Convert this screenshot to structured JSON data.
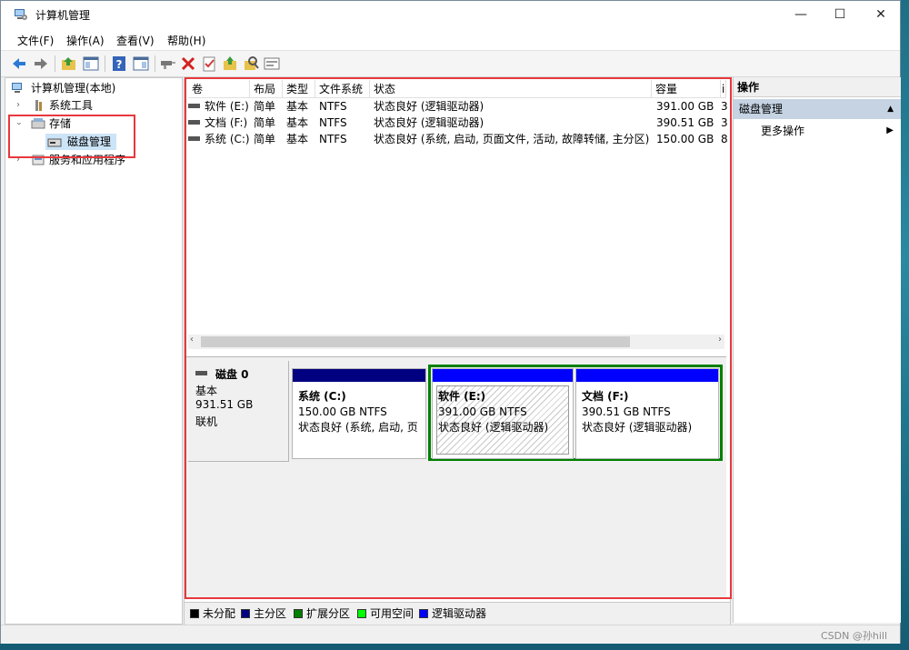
{
  "window": {
    "title": "计算机管理"
  },
  "menu": [
    "文件(F)",
    "操作(A)",
    "查看(V)",
    "帮助(H)"
  ],
  "tree": {
    "root": "计算机管理(本地)",
    "system_tools": "系统工具",
    "storage": "存储",
    "disk_mgmt": "磁盘管理",
    "services": "服务和应用程序"
  },
  "volumes": {
    "headers": [
      "卷",
      "布局",
      "类型",
      "文件系统",
      "状态",
      "容量",
      "i"
    ],
    "rows": [
      {
        "name": "软件 (E:)",
        "layout": "简单",
        "type": "基本",
        "fs": "NTFS",
        "status": "状态良好 (逻辑驱动器)",
        "capacity": "391.00 GB",
        "extra": "3"
      },
      {
        "name": "文档 (F:)",
        "layout": "简单",
        "type": "基本",
        "fs": "NTFS",
        "status": "状态良好 (逻辑驱动器)",
        "capacity": "390.51 GB",
        "extra": "3"
      },
      {
        "name": "系统 (C:)",
        "layout": "简单",
        "type": "基本",
        "fs": "NTFS",
        "status": "状态良好 (系统, 启动, 页面文件, 活动, 故障转储, 主分区)",
        "capacity": "150.00 GB",
        "extra": "8"
      }
    ]
  },
  "disk": {
    "name": "磁盘 0",
    "type": "基本",
    "size": "931.51 GB",
    "state": "联机",
    "partitions": [
      {
        "label": "系统  (C:)",
        "size": "150.00 GB NTFS",
        "status": "状态良好 (系统, 启动, 页"
      },
      {
        "label": "软件  (E:)",
        "size": "391.00 GB NTFS",
        "status": "状态良好 (逻辑驱动器)"
      },
      {
        "label": "文档  (F:)",
        "size": "390.51 GB NTFS",
        "status": "状态良好 (逻辑驱动器)"
      }
    ]
  },
  "legend": [
    {
      "label": "未分配",
      "color": "#000000"
    },
    {
      "label": "主分区",
      "color": "#000080"
    },
    {
      "label": "扩展分区",
      "color": "#008000"
    },
    {
      "label": "可用空间",
      "color": "#00ff00"
    },
    {
      "label": "逻辑驱动器",
      "color": "#0000ff"
    }
  ],
  "actions": {
    "header": "操作",
    "selected": "磁盘管理",
    "more": "更多操作"
  },
  "watermark": "CSDN @孙hill",
  "icons": [
    "computer-mgmt-icon",
    "back-icon",
    "forward-icon",
    "up-icon",
    "show-hide-tree-icon",
    "help-icon",
    "delete-icon",
    "properties-icon",
    "disk-icon"
  ]
}
